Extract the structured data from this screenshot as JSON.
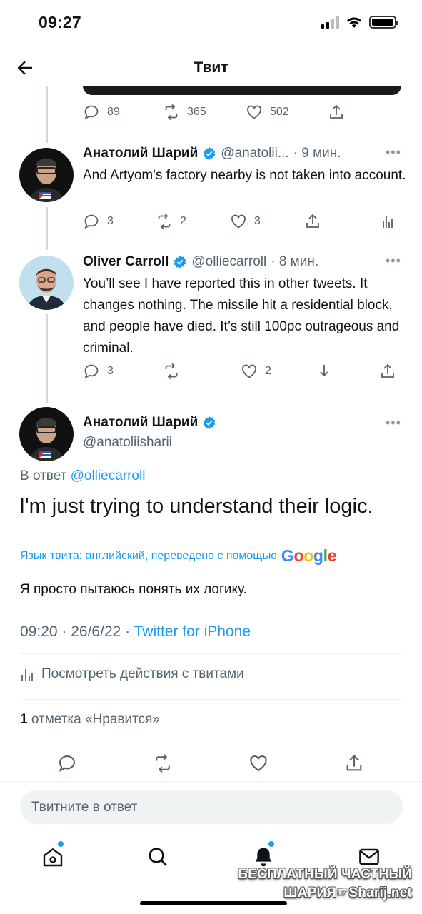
{
  "status_bar": {
    "time": "09:27"
  },
  "header": {
    "title": "Твит"
  },
  "top_actions": {
    "replies": "89",
    "retweets": "365",
    "likes": "502"
  },
  "replies": [
    {
      "name": "Анатолий Шарий",
      "handle": "@anatolii...",
      "time": "· 9 мин.",
      "text": "And Artyom's factory nearby is not taken into account.",
      "replies": "3",
      "retweets": "2",
      "likes": "3"
    },
    {
      "name": "Oliver Carroll",
      "handle": "@olliecarroll",
      "time": "· 8 мин.",
      "text": "You’ll see I have reported this in other tweets. It changes nothing. The missile hit a residential block, and people have died. It’s still 100pc outrageous and criminal.",
      "replies": "3",
      "likes": "2"
    }
  ],
  "main_tweet": {
    "name": "Анатолий Шарий",
    "handle": "@anatoliisharii",
    "reply_to_prefix": "В ответ",
    "reply_to_handle": "@olliecarroll",
    "text": "I'm just trying to understand their logic.",
    "translation_label": "Язык твита: английский, переведено с помощью",
    "translation_provider": "Google",
    "translated_text": "Я просто пытаюсь понять их логику.",
    "time": "09:20",
    "date": "26/6/22",
    "source": "Twitter for iPhone",
    "analytics_label": "Посмотреть действия с твитами",
    "likes_count": "1",
    "likes_label": "отметка «Нравится»"
  },
  "compose": {
    "placeholder": "Твитните в ответ"
  },
  "watermark": {
    "line1": "БЕСПЛАТНЫЙ ЧАСТНЫЙ",
    "line2": "ШАРИЯ☞Sharij.net"
  },
  "colors": {
    "accent": "#1d9bf0",
    "text": "#0f1419",
    "muted": "#536471"
  }
}
